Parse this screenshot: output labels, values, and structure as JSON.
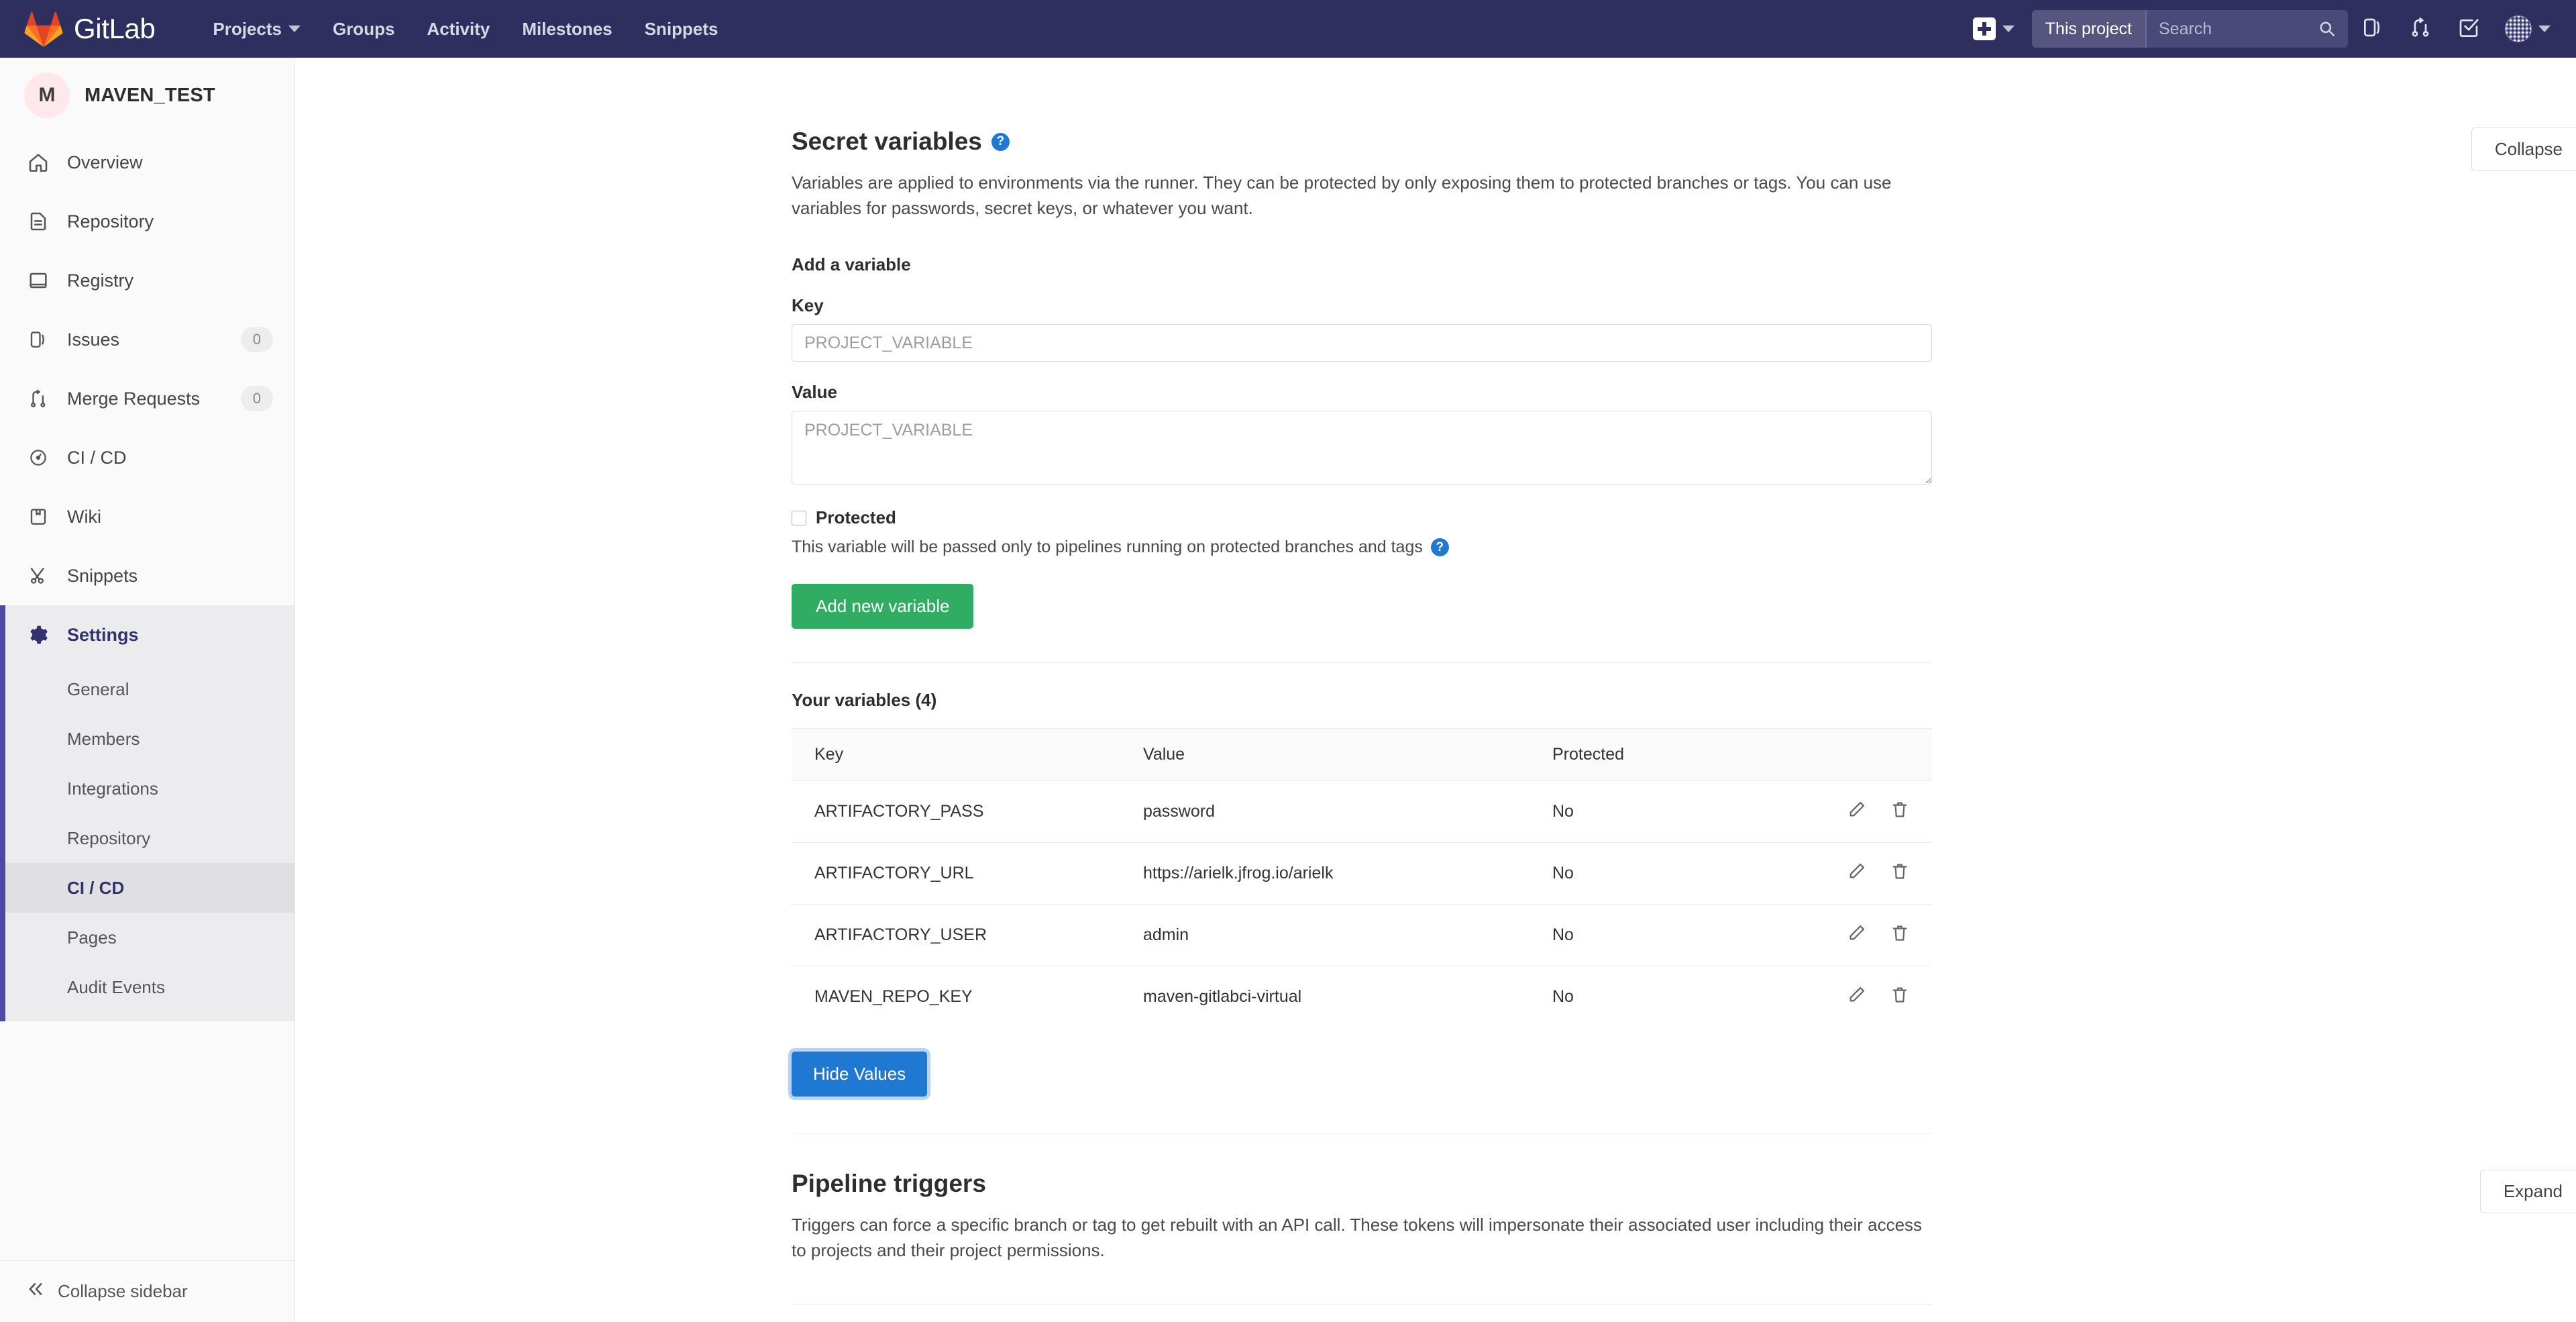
{
  "navbar": {
    "brand": "GitLab",
    "links": [
      {
        "label": "Projects",
        "has_caret": true
      },
      {
        "label": "Groups",
        "has_caret": false
      },
      {
        "label": "Activity",
        "has_caret": false
      },
      {
        "label": "Milestones",
        "has_caret": false
      },
      {
        "label": "Snippets",
        "has_caret": false
      }
    ],
    "search_scope": "This project",
    "search_placeholder": "Search",
    "search_value": ""
  },
  "sidebar": {
    "project_initial": "M",
    "project_name": "MAVEN_TEST",
    "items": [
      {
        "label": "Overview",
        "icon": "home-icon",
        "badge": ""
      },
      {
        "label": "Repository",
        "icon": "document-icon",
        "badge": ""
      },
      {
        "label": "Registry",
        "icon": "package-icon",
        "badge": ""
      },
      {
        "label": "Issues",
        "icon": "issues-icon",
        "badge": "0"
      },
      {
        "label": "Merge Requests",
        "icon": "merge-request-icon",
        "badge": "0"
      },
      {
        "label": "CI / CD",
        "icon": "rocket-icon",
        "badge": ""
      },
      {
        "label": "Wiki",
        "icon": "book-icon",
        "badge": ""
      },
      {
        "label": "Snippets",
        "icon": "scissors-icon",
        "badge": ""
      },
      {
        "label": "Settings",
        "icon": "gear-icon",
        "badge": ""
      }
    ],
    "subitems": [
      {
        "label": "General"
      },
      {
        "label": "Members"
      },
      {
        "label": "Integrations"
      },
      {
        "label": "Repository"
      },
      {
        "label": "CI / CD"
      },
      {
        "label": "Pages"
      },
      {
        "label": "Audit Events"
      }
    ],
    "collapse_label": "Collapse sidebar"
  },
  "secret_variables": {
    "title": "Secret variables",
    "help_glyph": "?",
    "description": "Variables are applied to environments via the runner. They can be protected by only exposing them to protected branches or tags. You can use variables for passwords, secret keys, or whatever you want.",
    "collapse_label": "Collapse",
    "add_heading": "Add a variable",
    "key_label": "Key",
    "key_placeholder": "PROJECT_VARIABLE",
    "key_value": "",
    "value_label": "Value",
    "value_placeholder": "PROJECT_VARIABLE",
    "value_value": "",
    "protected_label": "Protected",
    "protected_checked": false,
    "protected_hint": "This variable will be passed only to pipelines running on protected branches and tags",
    "add_button": "Add new variable",
    "table_heading": "Your variables (4)",
    "columns": [
      "Key",
      "Value",
      "Protected"
    ],
    "rows": [
      {
        "key": "ARTIFACTORY_PASS",
        "value": "password",
        "protected": "No"
      },
      {
        "key": "ARTIFACTORY_URL",
        "value": "https://arielk.jfrog.io/arielk",
        "protected": "No"
      },
      {
        "key": "ARTIFACTORY_USER",
        "value": "admin",
        "protected": "No"
      },
      {
        "key": "MAVEN_REPO_KEY",
        "value": "maven-gitlabci-virtual",
        "protected": "No"
      }
    ],
    "hide_values_button": "Hide Values"
  },
  "pipeline_triggers": {
    "title": "Pipeline triggers",
    "description": "Triggers can force a specific branch or tag to get rebuilt with an API call. These tokens will impersonate their associated user including their access to projects and their project permissions.",
    "expand_label": "Expand"
  },
  "colors": {
    "navbar_bg": "#2e2e5f",
    "accent_blue": "#1f78d1",
    "success_green": "#31ad63",
    "active_purple": "#4b4ba3"
  }
}
